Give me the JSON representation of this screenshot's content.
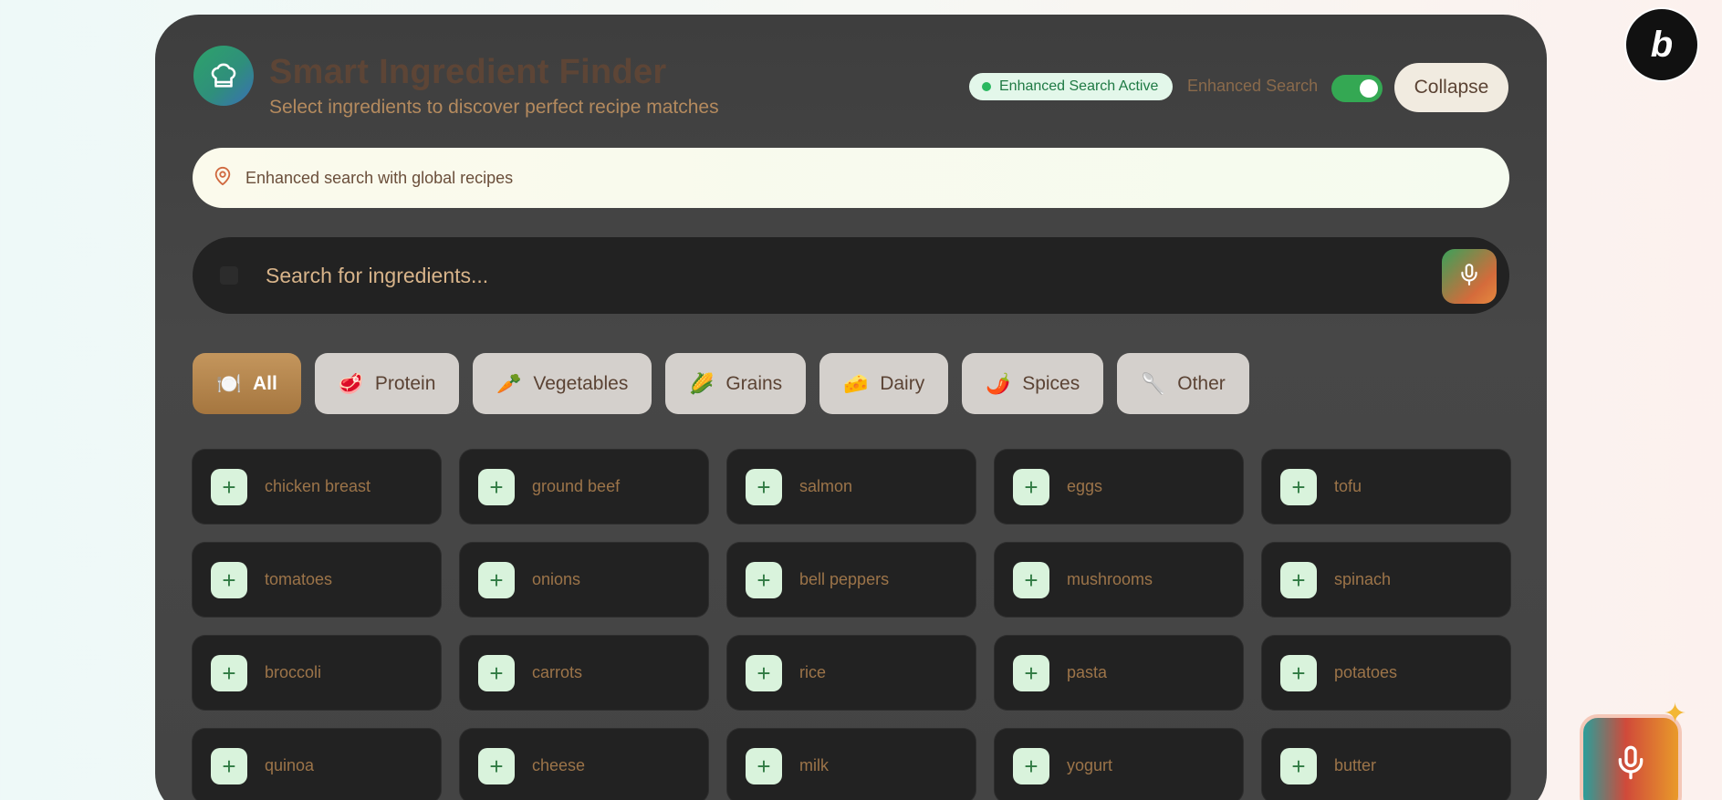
{
  "header": {
    "title": "Smart Ingredient Finder",
    "subtitle": "Select ingredients to discover perfect recipe matches",
    "status": "Enhanced Search Active",
    "toggle_label": "Enhanced Search",
    "toggle_on": true,
    "collapse_label": "Collapse"
  },
  "location": {
    "text": "Enhanced search with global recipes"
  },
  "search": {
    "placeholder": "Search for ingredients..."
  },
  "categories": [
    {
      "label": "All",
      "emoji": "🍽️",
      "active": true
    },
    {
      "label": "Protein",
      "emoji": "🥩",
      "active": false
    },
    {
      "label": "Vegetables",
      "emoji": "🥕",
      "active": false
    },
    {
      "label": "Grains",
      "emoji": "🌽",
      "active": false
    },
    {
      "label": "Dairy",
      "emoji": "🧀",
      "active": false
    },
    {
      "label": "Spices",
      "emoji": "🌶️",
      "active": false
    },
    {
      "label": "Other",
      "emoji": "🥄",
      "active": false
    }
  ],
  "ingredients": [
    "chicken breast",
    "ground beef",
    "salmon",
    "eggs",
    "tofu",
    "tomatoes",
    "onions",
    "bell peppers",
    "mushrooms",
    "spinach",
    "broccoli",
    "carrots",
    "rice",
    "pasta",
    "potatoes",
    "quinoa",
    "cheese",
    "milk",
    "yogurt",
    "butter"
  ],
  "colors": {
    "accent": "#a5763f",
    "toggle": "#34a853",
    "plus_bg": "#d9f3dc"
  }
}
